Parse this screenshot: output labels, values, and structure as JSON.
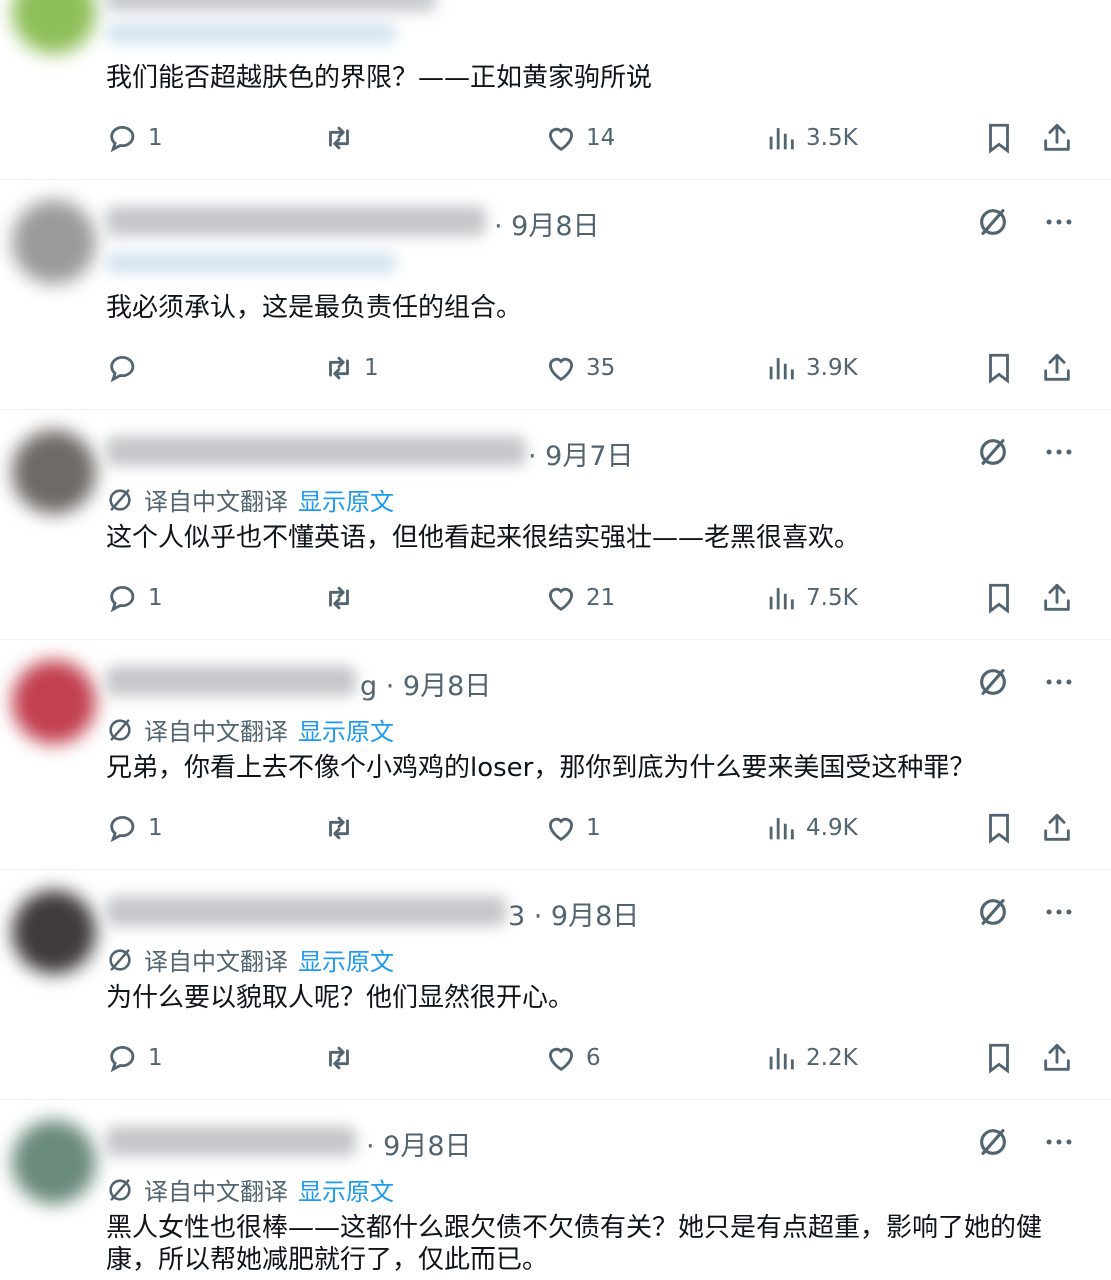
{
  "colors": {
    "text": "#0f1419",
    "muted": "#536471",
    "link": "#1d9bf0",
    "divider": "#eff3f4"
  },
  "translate": {
    "label": "译自中文翻译",
    "show_original": "显示原文"
  },
  "replies": [
    {
      "date": "",
      "text": "我们能否超越肤色的界限？——正如黄家驹所说",
      "replies": "1",
      "retweets": "",
      "likes": "14",
      "views": "3.5K"
    },
    {
      "date": "· 9月8日",
      "text": "我必须承认，这是最负责任的组合。",
      "replies": "",
      "retweets": "1",
      "likes": "35",
      "views": "3.9K"
    },
    {
      "date": "· 9月7日",
      "text": "这个人似乎也不懂英语，但他看起来很结实强壮——老黑很喜欢。",
      "replies": "1",
      "retweets": "",
      "likes": "21",
      "views": "7.5K"
    },
    {
      "date": "g · 9月8日",
      "text": "兄弟，你看上去不像个小鸡鸡的loser，那你到底为什么要来美国受这种罪？",
      "replies": "1",
      "retweets": "",
      "likes": "1",
      "views": "4.9K"
    },
    {
      "date": "3 · 9月8日",
      "text": "为什么要以貌取人呢？他们显然很开心。",
      "replies": "1",
      "retweets": "",
      "likes": "6",
      "views": "2.2K"
    },
    {
      "date": "· 9月8日",
      "text": "黑人女性也很棒——这都什么跟欠债不欠债有关？她只是有点超重，影响了她的健康，所以帮她减肥就行了，仅此而已。",
      "replies": "",
      "retweets": "",
      "likes": "",
      "views": ""
    }
  ]
}
